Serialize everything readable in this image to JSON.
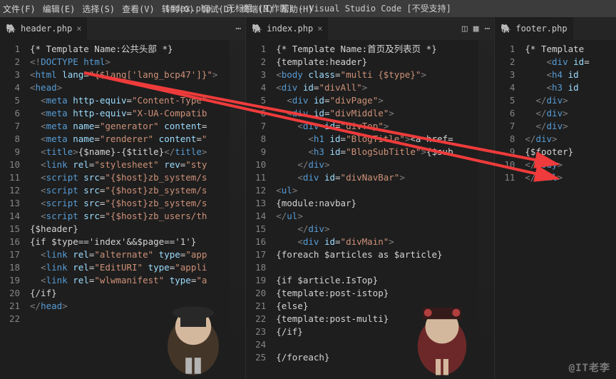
{
  "menu": {
    "items": [
      "文件(F)",
      "编辑(E)",
      "选择(S)",
      "查看(V)",
      "转到(G)",
      "调试(D)",
      "终端(M)",
      "帮助(H)"
    ]
  },
  "window_title": "index.php - 无标题 (工作区) - Visual Studio Code [不受支持]",
  "watermark": "@IT老李",
  "pane1": {
    "tab": "header.php",
    "lines": [
      "{* Template Name:公共头部 *}",
      "<!DOCTYPE html>",
      "<html lang=\"{$lang['lang_bcp47']}\">",
      "<head>",
      "  <meta http-equiv=\"Content-Type\"",
      "  <meta http-equiv=\"X-UA-Compatib",
      "  <meta name=\"generator\" content=",
      "  <meta name=\"renderer\" content=\"",
      "  <title>{$name}-{$title}</title>",
      "  <link rel=\"stylesheet\" rev=\"sty",
      "  <script src=\"{$host}zb_system/s",
      "  <script src=\"{$host}zb_system/s",
      "  <script src=\"{$host}zb_system/s",
      "  <script src=\"{$host}zb_users/th",
      "{$header}",
      "{if $type=='index'&&$page=='1'}",
      "  <link rel=\"alternate\" type=\"app",
      "  <link rel=\"EditURI\" type=\"appli",
      "  <link rel=\"wlwmanifest\" type=\"a",
      "{/if}",
      "</head>",
      ""
    ]
  },
  "pane2": {
    "tab": "index.php",
    "lines": [
      "{* Template Name:首页及列表页 *}",
      "{template:header}",
      "<body class=\"multi {$type}\">",
      "<div id=\"divAll\">",
      "  <div id=\"divPage\">",
      "  <div id=\"divMiddle\">",
      "    <div id=\"divTop\">",
      "      <h1 id=\"BlogTitle\"><a href=",
      "      <h3 id=\"BlogSubTitle\">{$sub",
      "    </div>",
      "    <div id=\"divNavBar\">",
      "<ul>",
      "{module:navbar}",
      "</ul>",
      "    </div>",
      "    <div id=\"divMain\">",
      "{foreach $articles as $article}",
      "",
      "{if $article.IsTop}",
      "{template:post-istop}",
      "{else}",
      "{template:post-multi}",
      "{/if}",
      "",
      "{/foreach}"
    ]
  },
  "pane3": {
    "tab": "footer.php",
    "lines": [
      "{* Template",
      "    <div id=",
      "    <h4 id",
      "    <h3 id",
      "  </div>",
      "  </div>",
      "  </div>",
      "</div>",
      "{$footer}",
      "</body>",
      "</html>"
    ]
  }
}
